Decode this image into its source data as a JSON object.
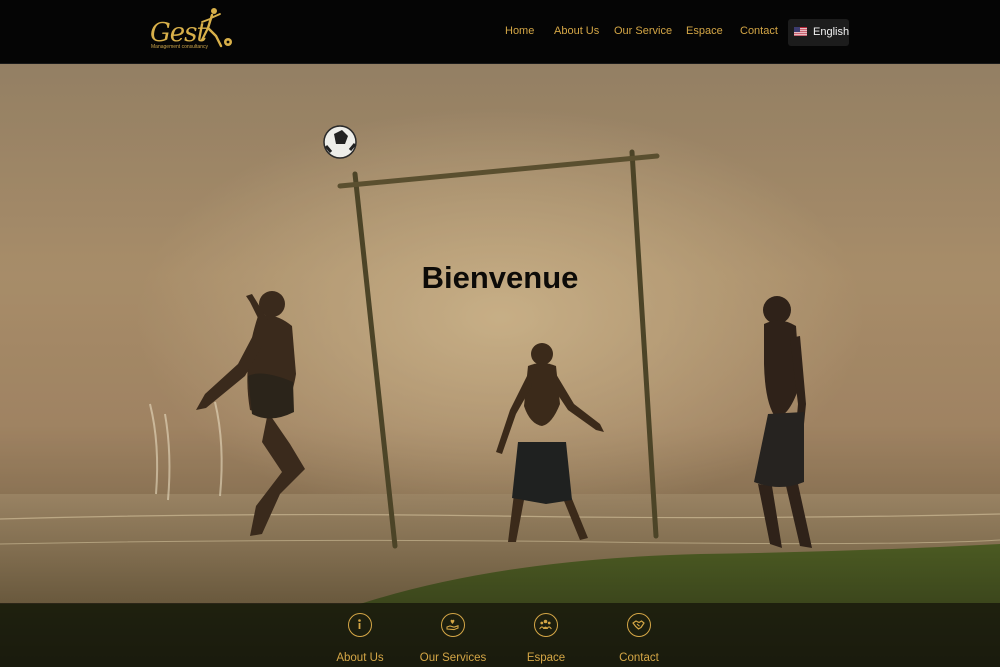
{
  "brand": {
    "logo_text": "Gest",
    "logo_tagline": "Management consultancy",
    "icon": "soccer-player-logo-icon",
    "accent_color": "#d4a646"
  },
  "nav": {
    "items": [
      {
        "label": "Home"
      },
      {
        "label": "About Us"
      },
      {
        "label": "Our Service"
      },
      {
        "label": "Espace"
      },
      {
        "label": "Contact"
      }
    ],
    "language": {
      "label": "English",
      "icon": "us-flag-icon"
    }
  },
  "hero": {
    "title": "Bienvenue",
    "image_icon": "kids-playing-football-photo"
  },
  "quick_links": [
    {
      "label": "About Us",
      "icon": "info-icon"
    },
    {
      "label": "Our Services",
      "icon": "hand-heart-icon"
    },
    {
      "label": "Espace",
      "icon": "group-icon"
    },
    {
      "label": "Contact",
      "icon": "handshake-icon"
    }
  ]
}
